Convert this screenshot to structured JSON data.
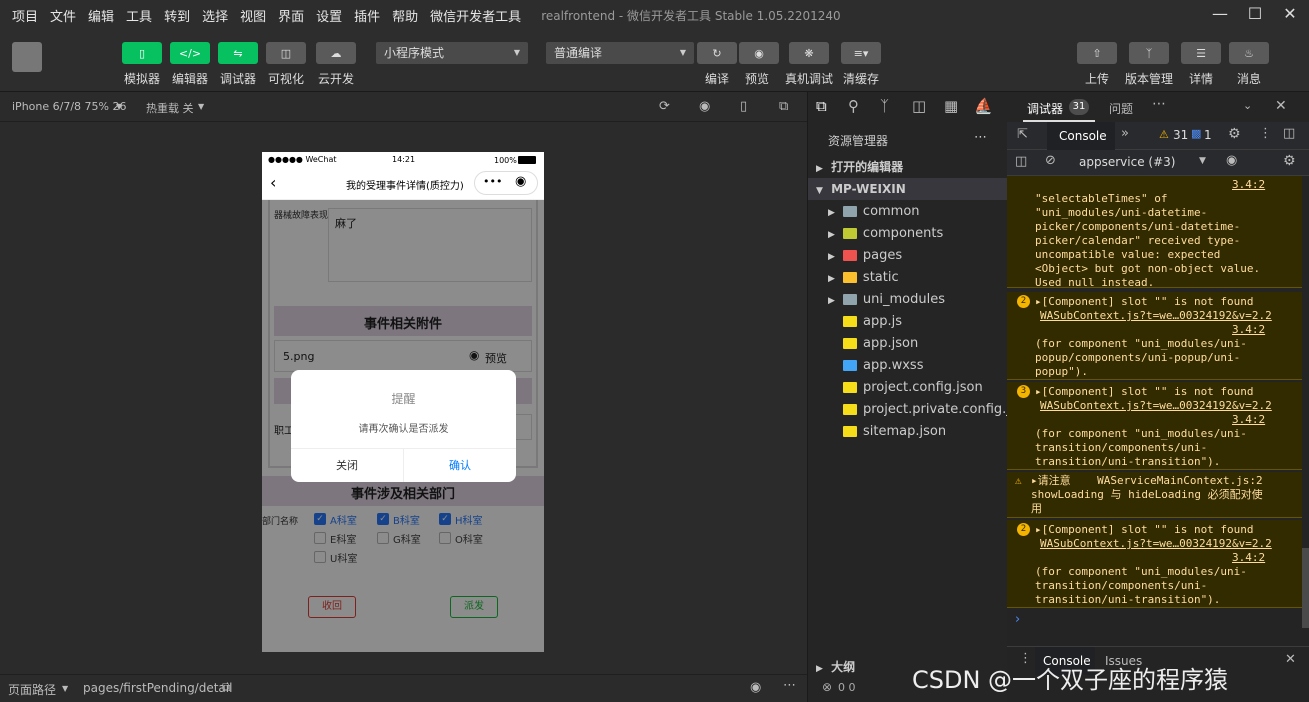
{
  "menu": {
    "items": [
      "项目",
      "文件",
      "编辑",
      "工具",
      "转到",
      "选择",
      "视图",
      "界面",
      "设置",
      "插件",
      "帮助",
      "微信开发者工具"
    ],
    "app_title": "realfrontend - 微信开发者工具 Stable 1.05.2201240"
  },
  "toolbar": {
    "simulator": "模拟器",
    "editor": "编辑器",
    "debugger": "调试器",
    "visual": "可视化",
    "cloud": "云开发",
    "mode_select": "小程序模式",
    "compile_select": "普通编译",
    "compile": "编译",
    "preview": "预览",
    "real_debug": "真机调试",
    "clear_cache": "清缓存",
    "upload": "上传",
    "version": "版本管理",
    "details": "详情",
    "messages": "消息"
  },
  "simbar": {
    "device": "iPhone 6/7/8 75% 26",
    "hot_reload": "热重载 关"
  },
  "phone": {
    "status_left": "●●●●● WeChat",
    "status_time": "14:21",
    "status_right": "100%",
    "nav_title": "我的受理事件详情(质控力)",
    "field_label": "器械故障表现",
    "field_value": "麻了",
    "section_attach": "事件相关附件",
    "file_name": "5.png",
    "preview_label": "预览",
    "partial_label": "职工",
    "section_depts": "事件涉及相关部门",
    "dept_label": "部门名称",
    "depts": [
      {
        "name": "A科室",
        "checked": true
      },
      {
        "name": "B科室",
        "checked": true
      },
      {
        "name": "H科室",
        "checked": true
      },
      {
        "name": "E科室",
        "checked": false
      },
      {
        "name": "G科室",
        "checked": false
      },
      {
        "name": "O科室",
        "checked": false
      },
      {
        "name": "U科室",
        "checked": false
      }
    ],
    "btn_recall": "收回",
    "btn_dispatch": "派发",
    "dialog": {
      "title": "提醒",
      "content": "请再次确认是否派发",
      "cancel": "关闭",
      "confirm": "确认"
    }
  },
  "status": {
    "path_label": "页面路径",
    "path": "pages/firstPending/detail"
  },
  "explorer": {
    "title": "资源管理器",
    "open_editors": "打开的编辑器",
    "root": "MP-WEIXIN",
    "entries": [
      {
        "name": "common",
        "kind": "folder",
        "color": "#90a4ae"
      },
      {
        "name": "components",
        "kind": "folder",
        "color": "#c0ca33"
      },
      {
        "name": "pages",
        "kind": "folder",
        "color": "#ef5350"
      },
      {
        "name": "static",
        "kind": "folder",
        "color": "#fbc02d"
      },
      {
        "name": "uni_modules",
        "kind": "folder",
        "color": "#90a4ae"
      },
      {
        "name": "app.js",
        "kind": "js",
        "color": "#f5de19"
      },
      {
        "name": "app.json",
        "kind": "json",
        "color": "#f5de19"
      },
      {
        "name": "app.wxss",
        "kind": "css",
        "color": "#42a5f5"
      },
      {
        "name": "project.config.json",
        "kind": "json",
        "color": "#f5de19"
      },
      {
        "name": "project.private.config.js...",
        "kind": "json",
        "color": "#f5de19"
      },
      {
        "name": "sitemap.json",
        "kind": "json",
        "color": "#f5de19"
      }
    ],
    "outline": "大纲",
    "problems": "0 0"
  },
  "debugger": {
    "tab": "调试器",
    "badge": "31",
    "issues_tab": "问题",
    "console_tab": "Console",
    "warn_count": "31",
    "info_count": "1",
    "context": "appservice (#3)",
    "bottom_console": "Console",
    "bottom_issues": "Issues",
    "messages": [
      {
        "lines": [
          "3.4:2",
          "\"selectableTimes\" of",
          "\"uni_modules/uni-datetime-",
          "picker/components/uni-datetime-",
          "picker/calendar\" received type-",
          "uncompatible value: expected",
          "<Object> but got non-object value.",
          "Used null instead."
        ]
      },
      {
        "count": "2",
        "lines": [
          "▸[Component] slot \"\" is not found",
          "WASubContext.js?t=we…00324192&v=2.2",
          "3.4:2",
          "(for component \"uni_modules/uni-",
          "popup/components/uni-popup/uni-",
          "popup\")."
        ]
      },
      {
        "count": "3",
        "lines": [
          "▸[Component] slot \"\" is not found",
          "WASubContext.js?t=we…00324192&v=2.2",
          "3.4:2",
          "(for component \"uni_modules/uni-",
          "transition/components/uni-",
          "transition/uni-transition\")."
        ]
      },
      {
        "lines": [
          "▸请注意    WAServiceMainContext.js:2",
          "showLoading 与 hideLoading 必须配对使",
          "用"
        ]
      },
      {
        "count": "2",
        "lines": [
          "▸[Component] slot \"\" is not found",
          "WASubContext.js?t=we…00324192&v=2.2",
          "3.4:2",
          "(for component \"uni_modules/uni-",
          "transition/components/uni-",
          "transition/uni-transition\")."
        ]
      }
    ]
  },
  "watermark": "CSDN @一个双子座的程序猿"
}
